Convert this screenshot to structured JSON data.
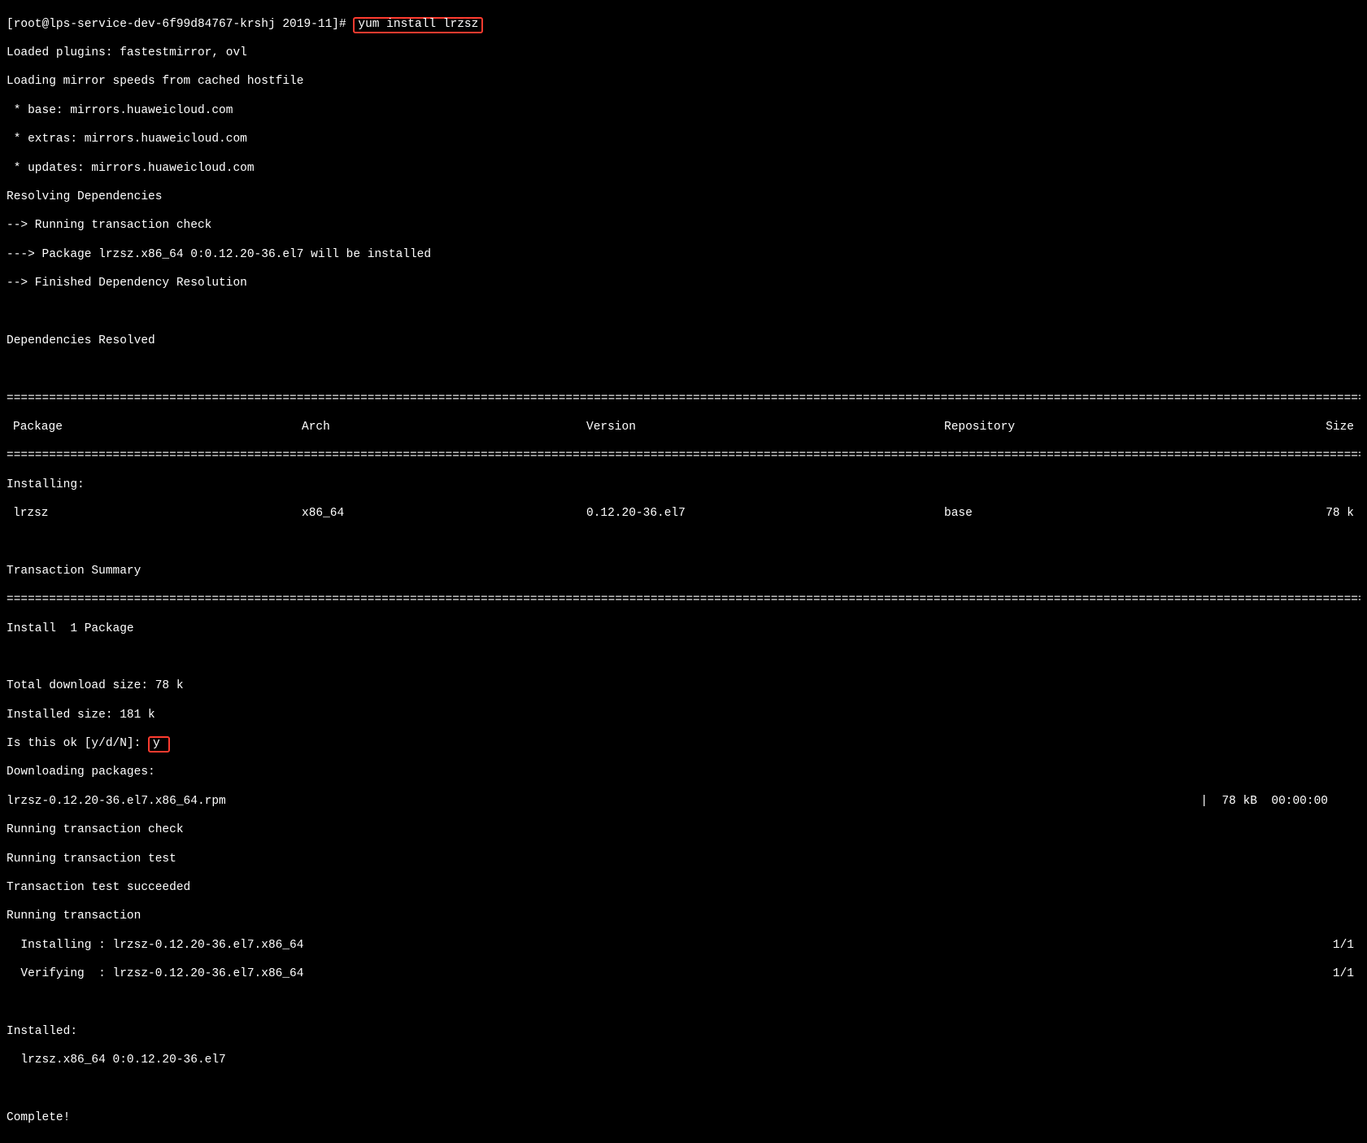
{
  "prompt": {
    "prefix": "[root@lps-service-dev-6f99d84767-krshj 2019-11]# ",
    "command": "yum install lrzsz"
  },
  "output": {
    "loaded_plugins": "Loaded plugins: fastestmirror, ovl",
    "loading_mirror": "Loading mirror speeds from cached hostfile",
    "mirror_base": " * base: mirrors.huaweicloud.com",
    "mirror_extras": " * extras: mirrors.huaweicloud.com",
    "mirror_updates": " * updates: mirrors.huaweicloud.com",
    "resolving": "Resolving Dependencies",
    "running_check": "--> Running transaction check",
    "pkg_line": "---> Package lrzsz.x86_64 0:0.12.20-36.el7 will be installed",
    "finished": "--> Finished Dependency Resolution",
    "dep_resolved": "Dependencies Resolved"
  },
  "table": {
    "headers": {
      "pkg": "Package",
      "arch": "Arch",
      "ver": "Version",
      "repo": "Repository",
      "size": "Size"
    },
    "installing_hdr": "Installing:",
    "row": {
      "pkg": "lrzsz",
      "arch": "x86_64",
      "ver": "0.12.20-36.el7",
      "repo": "base",
      "size": "78 k"
    }
  },
  "summary": {
    "title": "Transaction Summary",
    "install": "Install  1 Package",
    "dl_size": "Total download size: 78 k",
    "inst_size": "Installed size: 181 k",
    "confirm_q": "Is this ok [y/d/N]: ",
    "confirm_a": "y",
    "downloading": "Downloading packages:",
    "rpm": "lrzsz-0.12.20-36.el7.x86_64.rpm",
    "rpm_stat": "|  78 kB  00:00:00",
    "rtc": "Running transaction check",
    "rtt": "Running transaction test",
    "tts": "Transaction test succeeded",
    "rt": "Running transaction",
    "installing_line": "  Installing : lrzsz-0.12.20-36.el7.x86_64",
    "verifying_line": "  Verifying  : lrzsz-0.12.20-36.el7.x86_64",
    "progress": "1/1",
    "installed_hdr": "Installed:",
    "installed_pkg": "  lrzsz.x86_64 0:0.12.20-36.el7",
    "complete": "Complete!"
  }
}
